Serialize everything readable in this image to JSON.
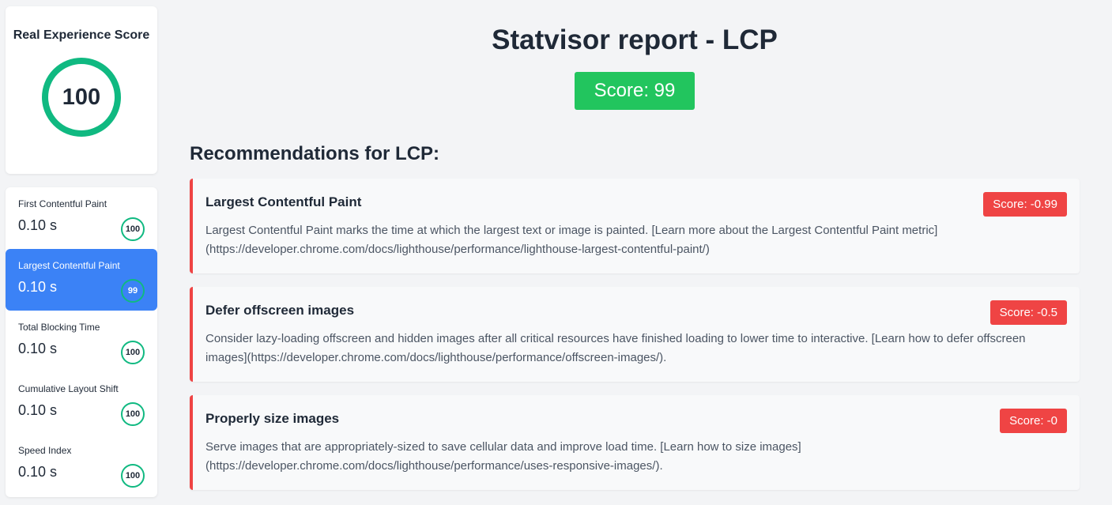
{
  "sidebar": {
    "score_card": {
      "title": "Real Experience Score",
      "value": "100",
      "ring_color": "#10b981"
    },
    "metrics": [
      {
        "name": "First Contentful Paint",
        "value": "0.10 s",
        "score": "100",
        "active": false
      },
      {
        "name": "Largest Contentful Paint",
        "value": "0.10 s",
        "score": "99",
        "active": true
      },
      {
        "name": "Total Blocking Time",
        "value": "0.10 s",
        "score": "100",
        "active": false
      },
      {
        "name": "Cumulative Layout Shift",
        "value": "0.10 s",
        "score": "100",
        "active": false
      },
      {
        "name": "Speed Index",
        "value": "0.10 s",
        "score": "100",
        "active": false
      }
    ]
  },
  "main": {
    "title": "Statvisor report - LCP",
    "score_label": "Score: 99",
    "recommendations_heading": "Recommendations for LCP:",
    "recommendations": [
      {
        "title": "Largest Contentful Paint",
        "score": "Score: -0.99",
        "description": "Largest Contentful Paint marks the time at which the largest text or image is painted. [Learn more about the Largest Contentful Paint metric](https://developer.chrome.com/docs/lighthouse/performance/lighthouse-largest-contentful-paint/)"
      },
      {
        "title": "Defer offscreen images",
        "score": "Score: -0.5",
        "description": "Consider lazy-loading offscreen and hidden images after all critical resources have finished loading to lower time to interactive. [Learn how to defer offscreen images](https://developer.chrome.com/docs/lighthouse/performance/offscreen-images/)."
      },
      {
        "title": "Properly size images",
        "score": "Score: -0",
        "description": "Serve images that are appropriately-sized to save cellular data and improve load time. [Learn how to size images](https://developer.chrome.com/docs/lighthouse/performance/uses-responsive-images/)."
      }
    ]
  },
  "colors": {
    "accent": "#3b82f6",
    "good": "#10b981",
    "score_pill": "#22c55e",
    "bad": "#ef4444"
  }
}
